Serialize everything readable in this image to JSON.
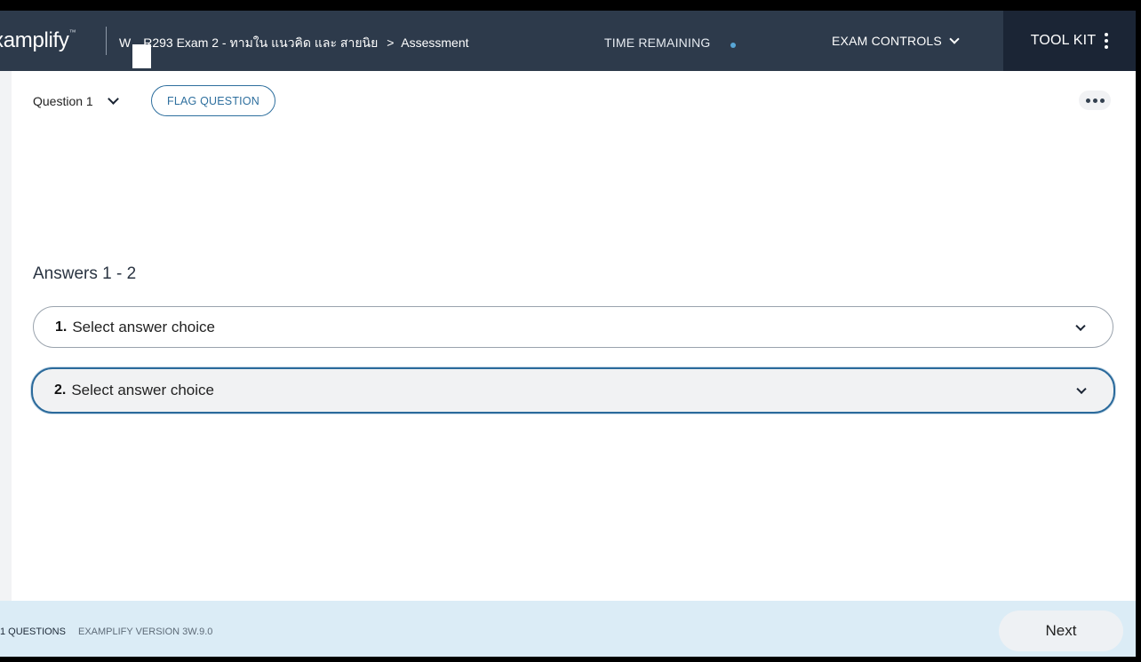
{
  "header": {
    "logo": "xamplify",
    "logo_mark": "™",
    "course_prefix": "W",
    "course_name": "R293 Exam 2 - ทามใน แนวคิด และ สายนิย",
    "breadcrumb_separator": ">",
    "breadcrumb_current": "Assessment",
    "time_remaining_label": "TIME REMAINING",
    "exam_controls_label": "EXAM CONTROLS",
    "toolkit_label": "TOOL KIT"
  },
  "question_bar": {
    "question_label": "Question 1",
    "flag_label": "FLAG QUESTION"
  },
  "answers": {
    "title": "Answers 1 - 2",
    "items": [
      {
        "number": "1.",
        "placeholder": "Select answer choice"
      },
      {
        "number": "2.",
        "placeholder": "Select answer choice"
      }
    ]
  },
  "footer": {
    "questions_count": "1 QUESTIONS",
    "version": "EXAMPLIFY VERSION 3W.9.0",
    "next_label": "Next"
  },
  "colors": {
    "header_bg": "#2d3a4b",
    "toolkit_bg": "#1b2535",
    "accent": "#2e6f9e",
    "footer_bg": "#dbecf6"
  }
}
